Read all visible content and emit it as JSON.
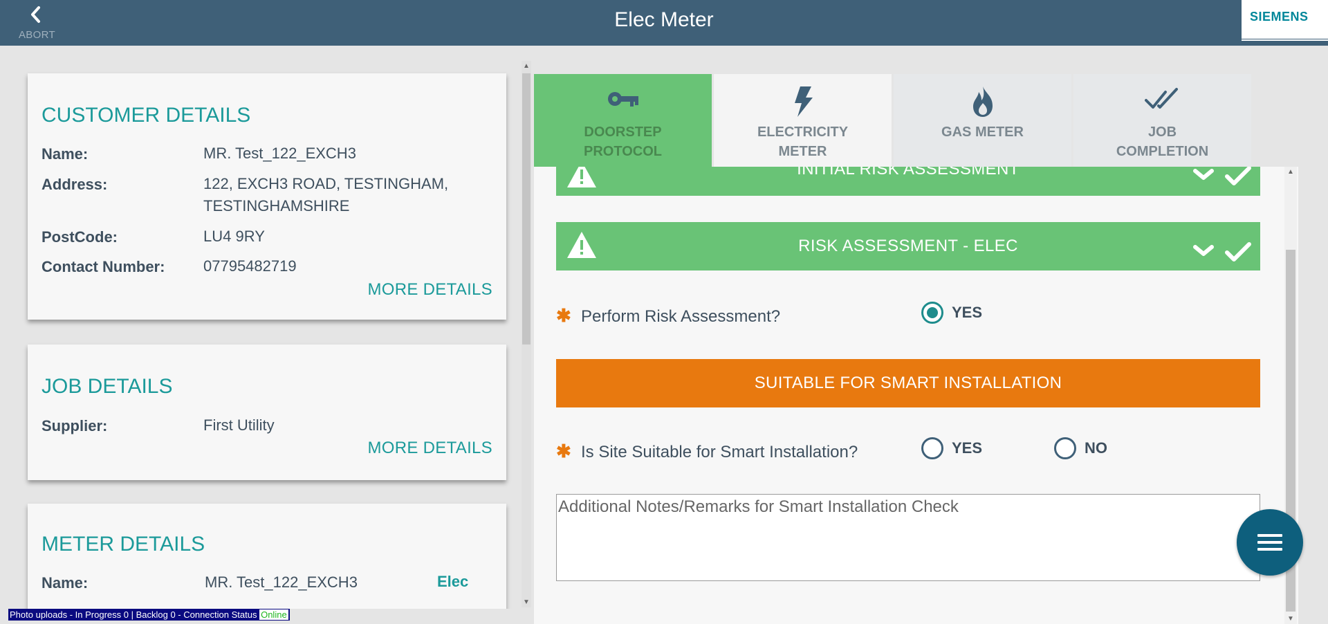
{
  "header": {
    "abort_label": "ABORT",
    "title": "Elec Meter",
    "brand": "SIEMENS",
    "color": "#3f6078"
  },
  "customer": {
    "title": "CUSTOMER DETAILS",
    "name_label": "Name:",
    "name_value": "MR. Test_122_EXCH3",
    "address_label": "Address:",
    "address_value": "122, EXCH3 ROAD, TESTINGHAM, TESTINGHAMSHIRE",
    "postcode_label": "PostCode:",
    "postcode_value": "LU4 9RY",
    "contact_label": "Contact Number:",
    "contact_value": "07795482719",
    "more": "MORE DETAILS"
  },
  "job": {
    "title": "JOB DETAILS",
    "supplier_label": "Supplier:",
    "supplier_value": "First Utility",
    "more": "MORE DETAILS"
  },
  "meter": {
    "title": "METER DETAILS",
    "name_label": "Name:",
    "name_value": "MR. Test_122_EXCH3",
    "type": "Elec"
  },
  "tabs": [
    {
      "line1": "DOORSTEP",
      "line2": "PROTOCOL",
      "icon": "key-icon",
      "state": "active"
    },
    {
      "line1": "ELECTRICITY",
      "line2": "METER",
      "icon": "lightning-icon",
      "state": "done"
    },
    {
      "line1": "GAS METER",
      "line2": "",
      "icon": "flame-icon",
      "state": "pending"
    },
    {
      "line1": "JOB",
      "line2": "COMPLETION",
      "icon": "double-check-icon",
      "state": "pending"
    }
  ],
  "sections": {
    "initial": "INITIAL RISK ASSESSMENT",
    "elec": "RISK ASSESSMENT - ELEC"
  },
  "questions": {
    "perform": "Perform Risk Assessment?",
    "perform_yes": "YES",
    "banner": "SUITABLE FOR SMART INSTALLATION",
    "site": "Is Site Suitable for Smart Installation?",
    "site_yes": "YES",
    "site_no": "NO",
    "notes_placeholder": "Additional Notes/Remarks for Smart Installation Check"
  },
  "colors": {
    "accent": "#1b9a9a",
    "green": "#69c376",
    "orange": "#e8790f",
    "fab": "#0e5f7d"
  },
  "status": {
    "text": "Photo uploads - In Progress 0 | Backlog 0 - Connection Status ",
    "online": "Online"
  }
}
